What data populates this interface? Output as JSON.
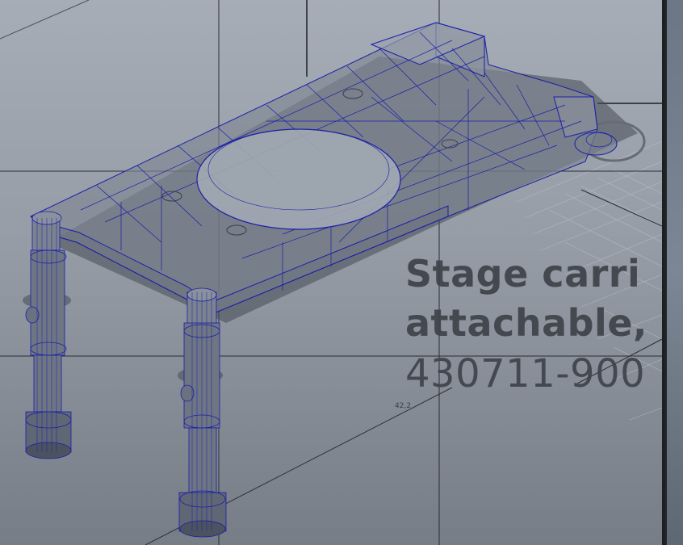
{
  "viewport": {
    "name": "3D modeling viewport",
    "background_top": "#a6adb7",
    "background_bottom": "#767d87",
    "wireframe_color": "#1a1fa8"
  },
  "annotation": {
    "line1": "Stage carri",
    "line2": "attachable,",
    "line3": "430711-900"
  },
  "measurement": {
    "value": "42,2"
  }
}
